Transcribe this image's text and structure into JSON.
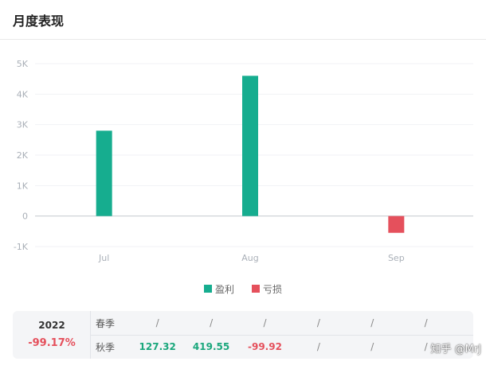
{
  "header": {
    "title": "月度表现"
  },
  "chart_data": {
    "type": "bar",
    "categories": [
      "Jul",
      "Aug",
      "Sep"
    ],
    "values": [
      2800,
      4600,
      -550
    ],
    "ylim": [
      -1000,
      5000
    ],
    "yticks": [
      "5K",
      "4K",
      "3K",
      "2K",
      "1K",
      "0",
      "-1K"
    ],
    "ytick_values": [
      5000,
      4000,
      3000,
      2000,
      1000,
      0,
      -1000
    ],
    "legend": [
      "盈利",
      "亏损"
    ],
    "legend_placement": "bottom-center",
    "colors": {
      "profit": "#16ad8f",
      "loss": "#e5505c"
    },
    "grid": true
  },
  "legend": {
    "profit_label": "盈利",
    "loss_label": "亏损"
  },
  "seasons": {
    "year": "2022",
    "year_pct": "-99.17%",
    "spring": {
      "label": "春季",
      "cells": [
        "/",
        "/",
        "/",
        "/",
        "/",
        "/"
      ]
    },
    "autumn": {
      "label": "秋季",
      "cells": [
        "127.32",
        "419.55",
        "-99.92",
        "/",
        "/",
        "/"
      ]
    }
  },
  "watermark": "知乎 @MrJ"
}
